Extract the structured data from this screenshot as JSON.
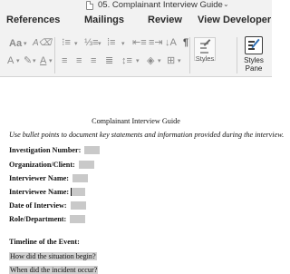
{
  "window": {
    "title": "05. Complainant Interview Guide"
  },
  "ribbon": {
    "tabs": [
      "References",
      "Mailings",
      "Review",
      "View",
      "Developer"
    ],
    "styles_label": "Styles",
    "styles_pane_label": "Styles Pane"
  },
  "document": {
    "heading": "Complainant Interview Guide",
    "instruction": "Use bullet points to document key statements and information provided during the interview.",
    "fields": [
      {
        "label": "Investigation Number:"
      },
      {
        "label": "Organization/Client:"
      },
      {
        "label": "Interviewer Name:"
      },
      {
        "label": "Interviewee Name:"
      },
      {
        "label": "Date of Interview:"
      },
      {
        "label": "Role/Department:"
      }
    ],
    "section_title": "Timeline of the Event:",
    "questions": [
      "How did the situation begin?",
      "When did the incident occur?"
    ]
  },
  "colors": {
    "chrome": "#f2f2f2",
    "field_shading": "#c9c9c9",
    "accent": "#2f6fb5"
  }
}
